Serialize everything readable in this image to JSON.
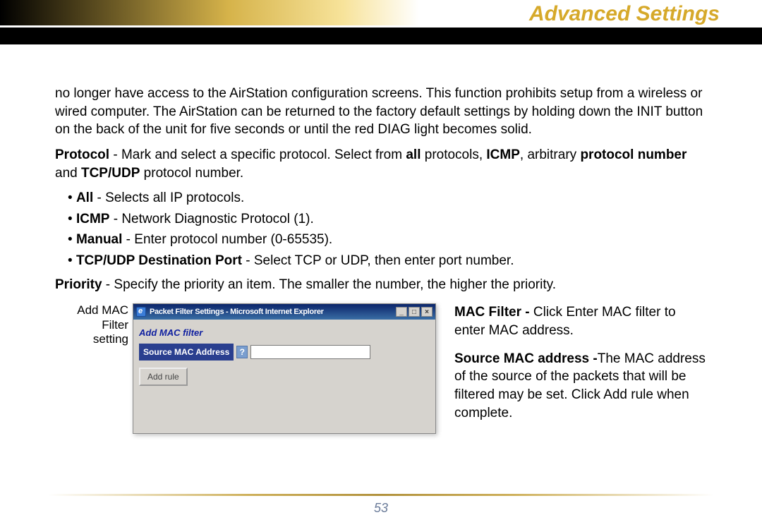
{
  "header": {
    "title": "Advanced Settings"
  },
  "body": {
    "intro": "no longer have access to the AirStation configuration screens.  This function prohibits setup from a wireless or wired computer.  The AirStation can be returned to the factory default settings by holding down the INIT button on the back of the unit for five seconds or until the red DIAG light becomes solid.",
    "protocol": {
      "label": "Protocol",
      "text_1": "  - Mark and select a specific protocol.  Select from ",
      "all_word": "all",
      "text_2": " protocols, ",
      "icmp_word": "ICMP",
      "text_3": ", arbitrary ",
      "pn_word": "protocol number",
      "text_4": " and ",
      "tcpudp_word": "TCP/UDP",
      "text_5": " protocol number."
    },
    "bullets": {
      "all_b": "All",
      "all_t": " - Selects all IP protocols.",
      "icmp_b": "ICMP",
      "icmp_t": " - Network Diagnostic Protocol (1).",
      "man_b": "Manual",
      "man_t": " - Enter protocol number (0-65535).",
      "tcp_b": "TCP/UDP Destination Port",
      "tcp_t": " - Select TCP or UDP, then enter port number."
    },
    "priority": {
      "label": "Priority",
      "text": " - Specify the priority  an item.  The smaller the number, the higher the priority."
    }
  },
  "figure": {
    "caption_l1": "Add MAC",
    "caption_l2": "Filter",
    "caption_l3": "setting",
    "window_title": "Packet Filter Settings - Microsoft Internet Explorer",
    "win_min": "_",
    "win_max": "□",
    "win_close": "×",
    "heading": "Add MAC filter",
    "field_label": "Source MAC Address",
    "help": "?",
    "button": "Add rule"
  },
  "right": {
    "mac_b": "MAC Filter - ",
    "mac_t": "Click Enter MAC filter to enter MAC address.",
    "src_b": "Source MAC address -",
    "src_t": "The MAC address of the source of the packets that will be filtered may be set. Click Add rule when complete."
  },
  "footer": {
    "page_number": "53"
  }
}
